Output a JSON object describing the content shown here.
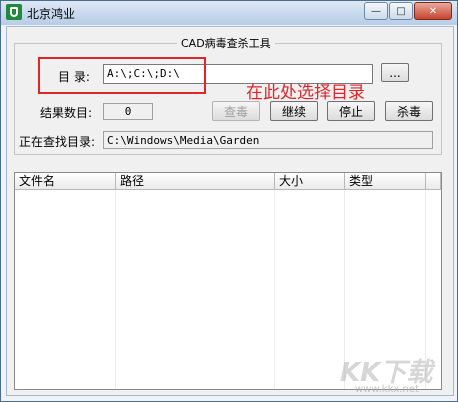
{
  "window": {
    "title": "北京鸿业",
    "minimize_glyph": "—",
    "maximize_glyph": "□",
    "close_glyph": "✕"
  },
  "group": {
    "title": "CAD病毒查杀工具"
  },
  "directory": {
    "label": "目 录:",
    "value": "A:\\;C:\\;D:\\",
    "browse_label": "..."
  },
  "annotation": {
    "text": "在此处选择目录",
    "color": "#e1262a"
  },
  "results": {
    "label": "结果数目:",
    "count": "0"
  },
  "buttons": {
    "scan": "查毒",
    "continue": "继续",
    "stop": "停止",
    "kill": "杀毒"
  },
  "current": {
    "label": "正在查找目录:",
    "path": "C:\\Windows\\Media\\Garden"
  },
  "list": {
    "columns": [
      "文件名",
      "路径",
      "大小",
      "类型"
    ]
  },
  "watermark": {
    "text": "KK下载",
    "url": "www.kkx.net"
  }
}
